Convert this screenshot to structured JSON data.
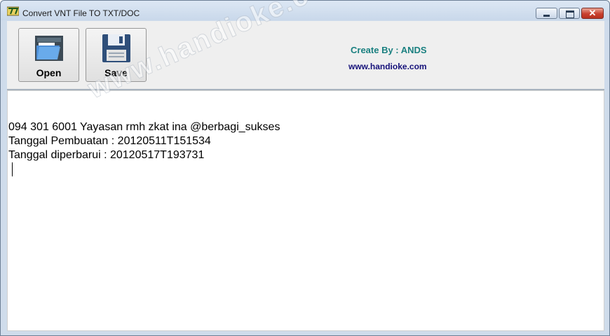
{
  "window": {
    "title": "Convert VNT File TO TXT/DOC",
    "controls": {
      "minimize_icon": "minimize-icon",
      "maximize_icon": "maximize-icon",
      "close_glyph": "✕"
    }
  },
  "toolbar": {
    "open_label": "Open",
    "save_label": "Save",
    "credit": "Create By : ANDS",
    "website": "www.handioke.com"
  },
  "editor": {
    "lines": [
      " 094 301 6001 Yayasan rmh zkat ina @berbagi_sukses",
      "Tanggal Pembuatan : 20120511T151534",
      "Tanggal diperbarui : 20120517T193731"
    ]
  },
  "watermark": "www.handioke.com",
  "colors": {
    "credit": "#1a8080",
    "website": "#16127a",
    "close_button": "#c8402f"
  }
}
